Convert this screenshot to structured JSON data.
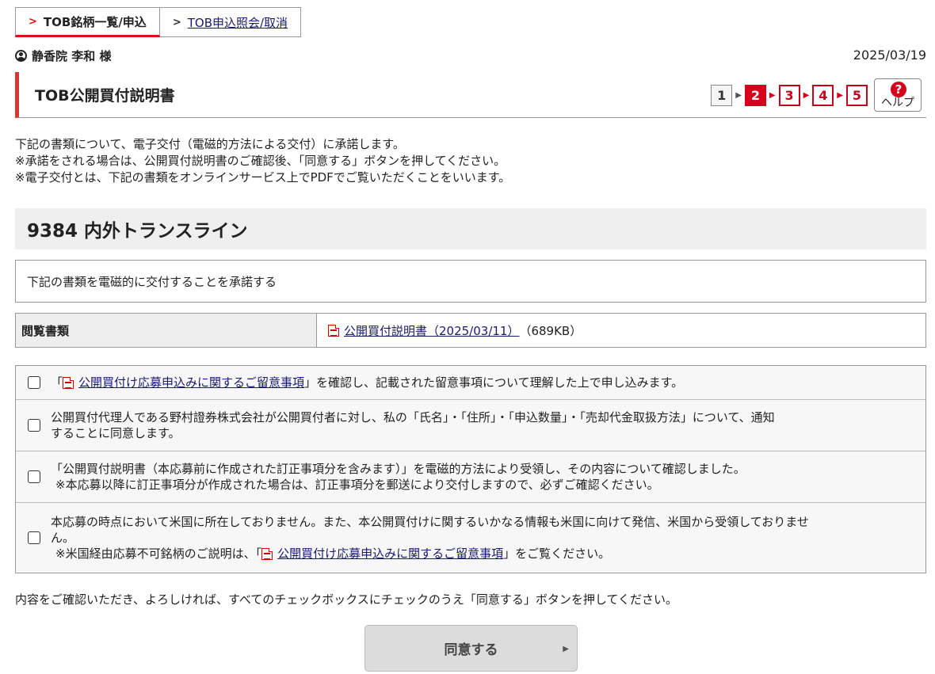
{
  "tabs": [
    {
      "label": "TOB銘柄一覧/申込"
    },
    {
      "label": "TOB申込照会/取消"
    }
  ],
  "user": {
    "name": "静香院 李和 様"
  },
  "date": "2025/03/19",
  "page_title": "TOB公開買付説明書",
  "steps": [
    "1",
    "2",
    "3",
    "4",
    "5"
  ],
  "help_label": "ヘルプ",
  "intro_lines": [
    "下記の書類について、電子交付（電磁的方法による交付）に承諾します。",
    "※承諾をされる場合は、公開買付説明書のご確認後、「同意する」ボタンを押してください。",
    "※電子交付とは、下記の書類をオンラインサービス上でPDFでご覧いただくことをいいます。"
  ],
  "company_name": "9384 内外トランスライン",
  "consent_text": "下記の書類を電磁的に交付することを承諾する",
  "doc_table": {
    "header": "閲覧書類",
    "link": "公開買付説明書（2025/03/11）",
    "size": "（689KB）"
  },
  "checks": {
    "row1": {
      "pre": "「",
      "link": "公開買付け応募申込みに関するご留意事項",
      "post": "」を確認し、記載された留意事項について理解した上で申し込みます。"
    },
    "row2": {
      "line1": "公開買付代理人である野村證券株式会社が公開買付者に対し、私の「氏名」・「住所」・「申込数量」・「売却代金取扱方法」について、通知",
      "line2": "することに同意します。"
    },
    "row3": {
      "line1": "「公開買付説明書（本応募前に作成された訂正事項分を含みます）」を電磁的方法により受領し、その内容について確認しました。",
      "line2": "※本応募以降に訂正事項分が作成された場合は、訂正事項分を郵送により交付しますので、必ずご確認ください。"
    },
    "row4": {
      "line1": "本応募の時点において米国に所在しておりません。また、本公開買付けに関するいかなる情報も米国に向けて発信、米国から受領しておりませ",
      "line2": "ん。",
      "line3_pre": "※米国経由応募不可銘柄のご説明は、「",
      "line3_link": "公開買付け応募申込みに関するご留意事項",
      "line3_post": "」をご覧ください。"
    }
  },
  "bottom_note": "内容をご確認いただき、よろしければ、すべてのチェックボックスにチェックのうえ「同意する」ボタンを押してください。",
  "agree_button": "同意する"
}
